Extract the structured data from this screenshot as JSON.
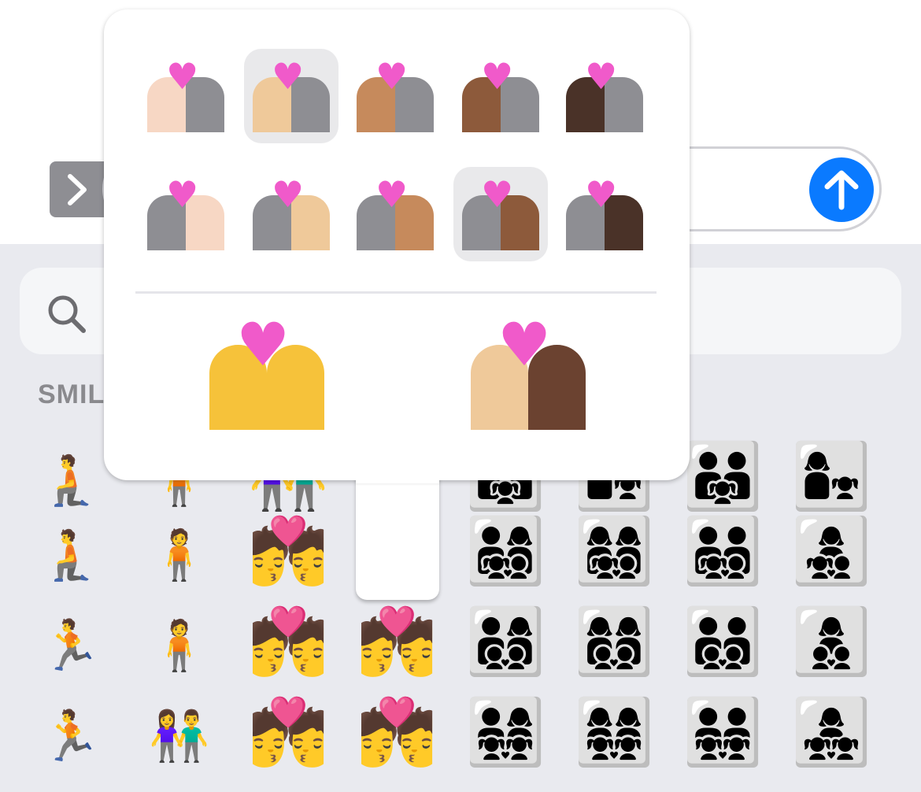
{
  "input": {
    "placeholder": ""
  },
  "icons": {
    "expand": "chevron-right-icon",
    "send": "arrow-up-icon",
    "search": "search-icon"
  },
  "colors": {
    "send": "#0a7aff",
    "heart": "#f05aca",
    "popup_bg": "#ffffff",
    "keyboard_bg": "#e9eaef",
    "gray": "#8e8e93"
  },
  "section": {
    "label": "SMILEYS & PEOPLE"
  },
  "popup": {
    "row1": [
      {
        "skin": "#f7d7c4",
        "selected": false
      },
      {
        "skin": "#efc99a",
        "selected": true
      },
      {
        "skin": "#c68a5c",
        "selected": false
      },
      {
        "skin": "#8d5a3b",
        "selected": false
      },
      {
        "skin": "#4a3228",
        "selected": false
      }
    ],
    "row2": [
      {
        "skin": "#f7d7c4",
        "selected": false
      },
      {
        "skin": "#efc99a",
        "selected": false
      },
      {
        "skin": "#c68a5c",
        "selected": false
      },
      {
        "skin": "#8d5a3b",
        "selected": true
      },
      {
        "skin": "#4a3228",
        "selected": false
      }
    ],
    "bottom": [
      {
        "left": "#f6c23a",
        "right": "#f6c23a"
      },
      {
        "left": "#efc99a",
        "right": "#6b4230"
      }
    ]
  },
  "grid": {
    "row1": [
      "🧎",
      "🧍",
      "👫",
      "👨‍👩‍👧",
      "👩‍👧",
      "👨‍👨‍👧",
      "👩‍👧"
    ],
    "row2": [
      "🧎",
      "🧍",
      "💏",
      "👨‍👩‍👧‍👦",
      "👩‍👩‍👧‍👦",
      "👨‍👨‍👧‍👦",
      "👩‍👧‍👦"
    ],
    "row3": [
      "🏃",
      "🧍",
      "💏",
      "💏",
      "👨‍👩‍👦‍👦",
      "👩‍👩‍👦‍👦",
      "👨‍👨‍👦‍👦",
      "👩‍👦‍👦"
    ],
    "row4": [
      "🏃",
      "👫",
      "💏",
      "💏",
      "👨‍👩‍👧‍👧",
      "👩‍👩‍👧‍👧",
      "👨‍👨‍👧‍👧",
      "👩‍👧‍👧"
    ]
  }
}
